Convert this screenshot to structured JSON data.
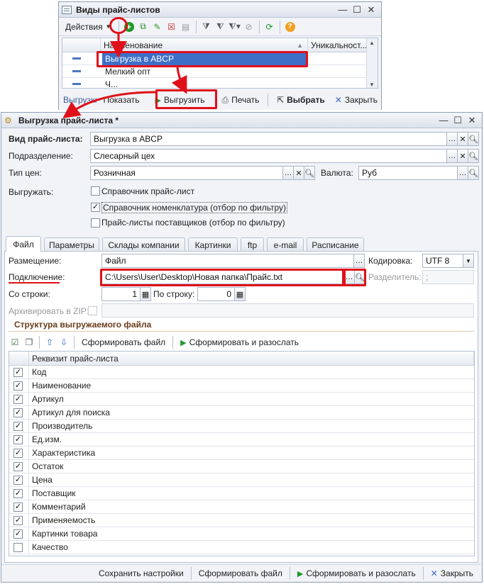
{
  "list_window": {
    "title": "Виды прайс-листов",
    "toolbar": {
      "actions_label": "Действия"
    },
    "columns": {
      "name": "Наименование",
      "unique": "Уникальност..."
    },
    "rows": [
      {
        "name": "Выгрузка в ABCP"
      },
      {
        "name": "Мелкий опт"
      },
      {
        "name": "Ч..."
      }
    ],
    "bottom": {
      "status": "Выгрузка в ...",
      "show": "Показать",
      "export": "Выгрузить",
      "print": "Печать",
      "select": "Выбрать",
      "close": "Закрыть"
    }
  },
  "form": {
    "title": "Выгрузка прайс-листа *",
    "pricelist_type_label": "Вид прайс-листа:",
    "pricelist_type_value": "Выгрузка в ABCP",
    "department_label": "Подразделение:",
    "department_value": "Слесарный цех",
    "price_type_label": "Тип цен:",
    "price_type_value": "Розничная",
    "currency_label": "Валюта:",
    "currency_value": "Руб",
    "export_label": "Выгружать:",
    "checkboxes": [
      {
        "label": "Справочник прайс-лист",
        "checked": false
      },
      {
        "label": "Справочник номенклатура (отбор по фильтру)",
        "checked": true
      },
      {
        "label": "Прайс-листы поставщиков (отбор по фильтру)",
        "checked": false
      }
    ],
    "tabs": [
      "Файл",
      "Параметры",
      "Склады компании",
      "Картинки",
      "ftp",
      "e-mail",
      "Расписание"
    ],
    "placement_label": "Размещение:",
    "placement_value": "Файл",
    "encoding_label": "Кодировка:",
    "encoding_value": "UTF 8",
    "connection_label": "Подключение:",
    "connection_value": "C:\\Users\\User\\Desktop\\Новая папка\\Прайс.txt",
    "separator_label": "Разделитель:",
    "separator_value": ";",
    "from_row_label": "Со строки:",
    "from_row_value": "1",
    "to_row_label": "По строку:",
    "to_row_value": "0",
    "archive_label": "Архивировать в ZIP:",
    "structure_title": "Структура выгружаемого файла",
    "structure_toolbar": {
      "form_file": "Сформировать файл",
      "form_send": "Сформировать и разослать"
    },
    "table_header": "Реквизит прайс-листа",
    "table_rows": [
      {
        "label": "Код",
        "checked": true
      },
      {
        "label": "Наименование",
        "checked": true
      },
      {
        "label": "Артикул",
        "checked": true
      },
      {
        "label": "Артикул для поиска",
        "checked": true
      },
      {
        "label": "Производитель",
        "checked": true
      },
      {
        "label": "Ед.изм.",
        "checked": true
      },
      {
        "label": "Характеристика",
        "checked": true
      },
      {
        "label": "Остаток",
        "checked": true
      },
      {
        "label": "Цена",
        "checked": true
      },
      {
        "label": "Поставщик",
        "checked": true
      },
      {
        "label": "Комментарий",
        "checked": true
      },
      {
        "label": "Применяемость",
        "checked": true
      },
      {
        "label": "Картинки товара",
        "checked": true
      },
      {
        "label": "Качество",
        "checked": false
      }
    ],
    "bottom": {
      "save_settings": "Сохранить настройки",
      "form_file": "Сформировать файл",
      "form_send": "Сформировать и разослать",
      "close": "Закрыть"
    }
  },
  "colors": {
    "accent_red": "#e0101a",
    "selection_blue": "#3e6fc8",
    "green": "#1e9a2a"
  }
}
